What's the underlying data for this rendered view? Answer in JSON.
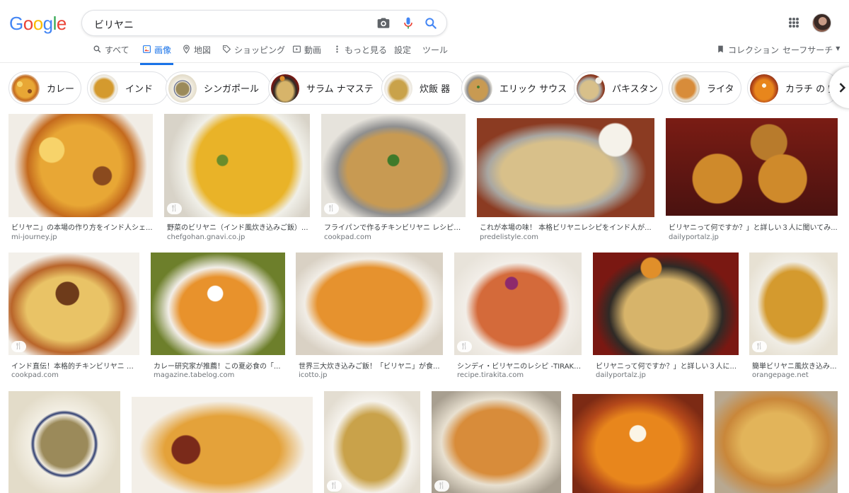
{
  "logo": "Google",
  "search": {
    "query": "ビリヤニ"
  },
  "tabs": [
    {
      "label": "すべて",
      "icon": "search-icon"
    },
    {
      "label": "画像",
      "icon": "image-icon",
      "active": true
    },
    {
      "label": "地図",
      "icon": "map-pin-icon"
    },
    {
      "label": "ショッピング",
      "icon": "tag-icon"
    },
    {
      "label": "動画",
      "icon": "play-icon"
    },
    {
      "label": "もっと見る",
      "icon": "more-vert-icon"
    },
    {
      "label": "設定"
    },
    {
      "label": "ツール"
    }
  ],
  "right_tools": {
    "collection": "コレクション",
    "safesearch": "セーフサーチ"
  },
  "chips": [
    {
      "label": "カレー"
    },
    {
      "label": "インド"
    },
    {
      "label": "シンガポール"
    },
    {
      "label": "サラム ナマステ"
    },
    {
      "label": "炊飯 器"
    },
    {
      "label": "エリック サウス"
    },
    {
      "label": "パキスタン"
    },
    {
      "label": "ライタ"
    },
    {
      "label": "カラチ の 空"
    }
  ],
  "results": [
    {
      "title": "ビリヤニ」の本場の作り方をインド人シェ...",
      "source": "mi-journey.jp",
      "recipe": false
    },
    {
      "title": "野菜のビリヤニ（インド風炊き込みご飯）...",
      "source": "chefgohan.gnavi.co.jp",
      "recipe": true
    },
    {
      "title": "フライパンで作るチキンビリヤニ レシピ・...",
      "source": "cookpad.com",
      "recipe": true
    },
    {
      "title": "これが本場の味！ 本格ビリヤニレシピをインド人が...",
      "source": "predelistyle.com",
      "recipe": false
    },
    {
      "title": "ビリヤニって何ですか？」と詳しい３人に聞いてみ...",
      "source": "dailyportalz.jp",
      "recipe": false
    },
    {
      "title": "インド直伝！本格的チキンビリヤニ レ...",
      "source": "cookpad.com",
      "recipe": true
    },
    {
      "title": "カレー研究家が推薦！この夏必食の「...",
      "source": "magazine.tabelog.com",
      "recipe": false
    },
    {
      "title": "世界三大炊き込みご飯！「ビリヤニ」が食...",
      "source": "icotto.jp",
      "recipe": false
    },
    {
      "title": "シンディ・ビリヤニのレシピ -TIRAKI...",
      "source": "recipe.tirakita.com",
      "recipe": true
    },
    {
      "title": "ビリヤニって何ですか？」と詳しい３人に...",
      "source": "dailyportalz.jp",
      "recipe": false
    },
    {
      "title": "簡単ビリヤニ風炊き込み...",
      "source": "orangepage.net",
      "recipe": true
    },
    {
      "title": "",
      "source": "",
      "recipe": false
    },
    {
      "title": "",
      "source": "",
      "recipe": false
    },
    {
      "title": "",
      "source": "",
      "recipe": true
    },
    {
      "title": "",
      "source": "",
      "recipe": true
    },
    {
      "title": "",
      "source": "",
      "recipe": false
    },
    {
      "title": "",
      "source": "",
      "recipe": false
    }
  ],
  "badge_icon": "fork-knife-icon",
  "colors": {
    "accent": "#1a73e8",
    "text": "#202124",
    "muted": "#5f6368",
    "source": "#70757a"
  }
}
